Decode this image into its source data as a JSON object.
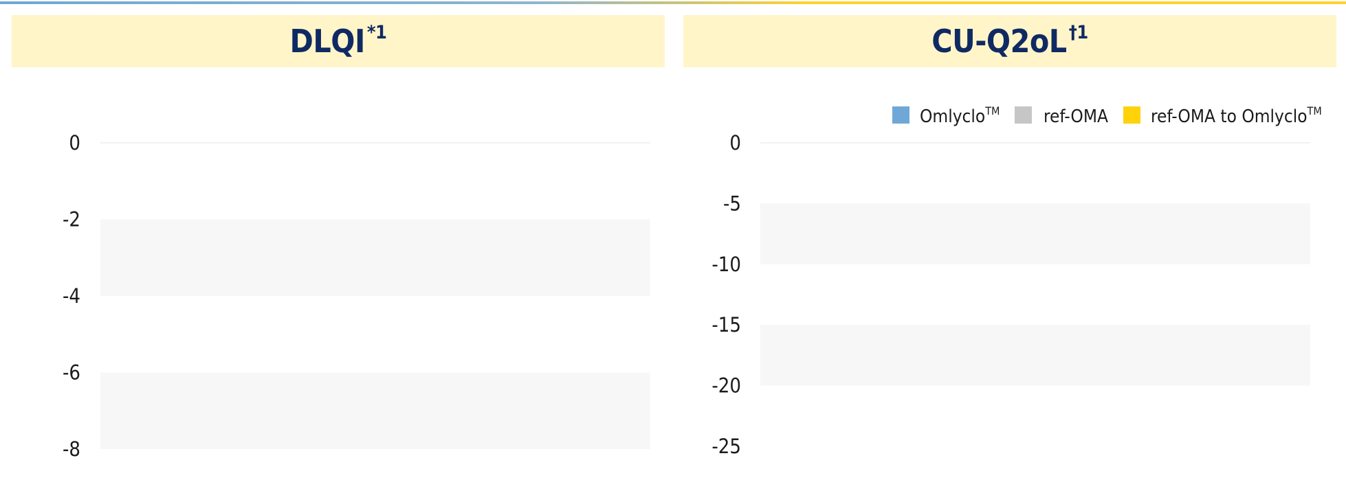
{
  "colors": {
    "header_bg": "#fff5c9",
    "title": "#0f2a63",
    "band": "#f7f7f7",
    "grid": "#e6e6e6",
    "top_line_left": "#6fa8d6",
    "top_line_right": "#ffd22e"
  },
  "chart_data": [
    {
      "type": "bar",
      "title": "DLQI",
      "title_mark": "*1",
      "xlabel": "",
      "ylabel": "",
      "ylim": [
        -8,
        0
      ],
      "yticks": [
        0,
        -2,
        -4,
        -6,
        -8
      ],
      "yticklabels": [
        "0",
        "-2",
        "-4",
        "-6",
        "-8"
      ],
      "grid": "alternating bands",
      "series": []
    },
    {
      "type": "bar",
      "title": "CU-Q2oL",
      "title_mark": "†1",
      "xlabel": "",
      "ylabel": "",
      "ylim": [
        -25,
        0
      ],
      "yticks": [
        0,
        -5,
        -10,
        -15,
        -20,
        -25
      ],
      "yticklabels": [
        "0",
        "-5",
        "-10",
        "-15",
        "-20",
        "-25"
      ],
      "grid": "alternating bands",
      "legend_position": "top-right",
      "legend": [
        {
          "name": "Omlyclo",
          "mark": "TM",
          "color": "#6fa8d6",
          "icon": "blue-square"
        },
        {
          "name": "ref-OMA",
          "mark": "",
          "color": "#c6c6c6",
          "icon": "gray-square"
        },
        {
          "name": "ref-OMA to Omlyclo",
          "mark": "TM",
          "color": "#ffd20a",
          "icon": "yellow-square"
        }
      ],
      "series": []
    }
  ]
}
